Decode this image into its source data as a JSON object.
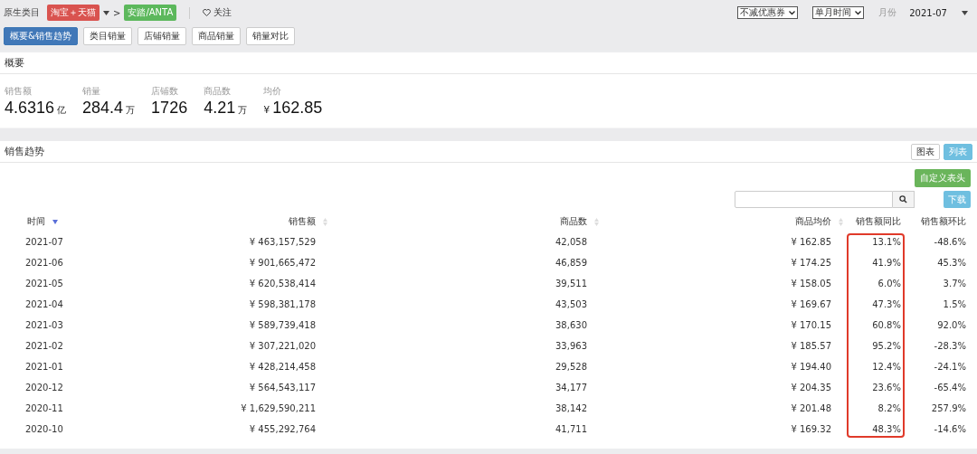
{
  "filter_bar": {
    "label": "原生类目",
    "tags": [
      {
        "text": "淘宝＋天猫",
        "color": "#d9534f"
      },
      {
        "text": "安踏/ANTA",
        "color": "#5cb85c"
      }
    ],
    "separator": ">",
    "follow": "关注",
    "selects": [
      {
        "value": "不减优惠券"
      },
      {
        "value": "单月时间"
      }
    ],
    "month_label": "月份",
    "month_value": "2021-07"
  },
  "tabs": [
    {
      "label": "概要&销售趋势",
      "selected": true
    },
    {
      "label": "类目销量",
      "selected": false
    },
    {
      "label": "店铺销量",
      "selected": false
    },
    {
      "label": "商品销量",
      "selected": false
    },
    {
      "label": "销量对比",
      "selected": false
    }
  ],
  "summary": {
    "title": "概要",
    "metrics": [
      {
        "label": "销售额",
        "value": "4.6316",
        "unit": "亿"
      },
      {
        "label": "销量",
        "value": "284.4",
        "unit": "万"
      },
      {
        "label": "店铺数",
        "value": "1726"
      },
      {
        "label": "商品数",
        "value": "4.21",
        "unit": "万"
      },
      {
        "label": "均价",
        "prefix": "¥",
        "value": "162.85"
      }
    ]
  },
  "trend": {
    "title": "销售趋势",
    "view_buttons": [
      {
        "label": "图表",
        "selected": false
      },
      {
        "label": "列表",
        "selected": true
      }
    ],
    "custom_header_button": "自定义表头",
    "download_button": "下载",
    "columns": [
      {
        "label": "时间",
        "sorted": true,
        "highlighted": false
      },
      {
        "label": "销售额",
        "sorted": false,
        "highlighted": false
      },
      {
        "label": "商品数",
        "sorted": false,
        "highlighted": false
      },
      {
        "label": "商品均价",
        "sorted": false,
        "highlighted": false
      },
      {
        "label": "销售额同比",
        "highlighted": true
      },
      {
        "label": "销售额环比",
        "highlighted": false
      }
    ],
    "rows": [
      [
        "2021-07",
        "¥ 463,157,529",
        "42,058",
        "¥ 162.85",
        "13.1%",
        "-48.6%"
      ],
      [
        "2021-06",
        "¥ 901,665,472",
        "46,859",
        "¥ 174.25",
        "41.9%",
        "45.3%"
      ],
      [
        "2021-05",
        "¥ 620,538,414",
        "39,511",
        "¥ 158.05",
        "6.0%",
        "3.7%"
      ],
      [
        "2021-04",
        "¥ 598,381,178",
        "43,503",
        "¥ 169.67",
        "47.3%",
        "1.5%"
      ],
      [
        "2021-03",
        "¥ 589,739,418",
        "38,630",
        "¥ 170.15",
        "60.8%",
        "92.0%"
      ],
      [
        "2021-02",
        "¥ 307,221,020",
        "33,963",
        "¥ 185.57",
        "95.2%",
        "-28.3%"
      ],
      [
        "2021-01",
        "¥ 428,214,458",
        "29,528",
        "¥ 194.40",
        "12.4%",
        "-24.1%"
      ],
      [
        "2020-12",
        "¥ 564,543,117",
        "34,177",
        "¥ 204.35",
        "23.6%",
        "-65.4%"
      ],
      [
        "2020-11",
        "¥ 1,629,590,211",
        "38,142",
        "¥ 201.48",
        "8.2%",
        "257.9%"
      ],
      [
        "2020-10",
        "¥ 455,292,764",
        "41,711",
        "¥ 169.32",
        "48.3%",
        "-14.6%"
      ]
    ]
  }
}
